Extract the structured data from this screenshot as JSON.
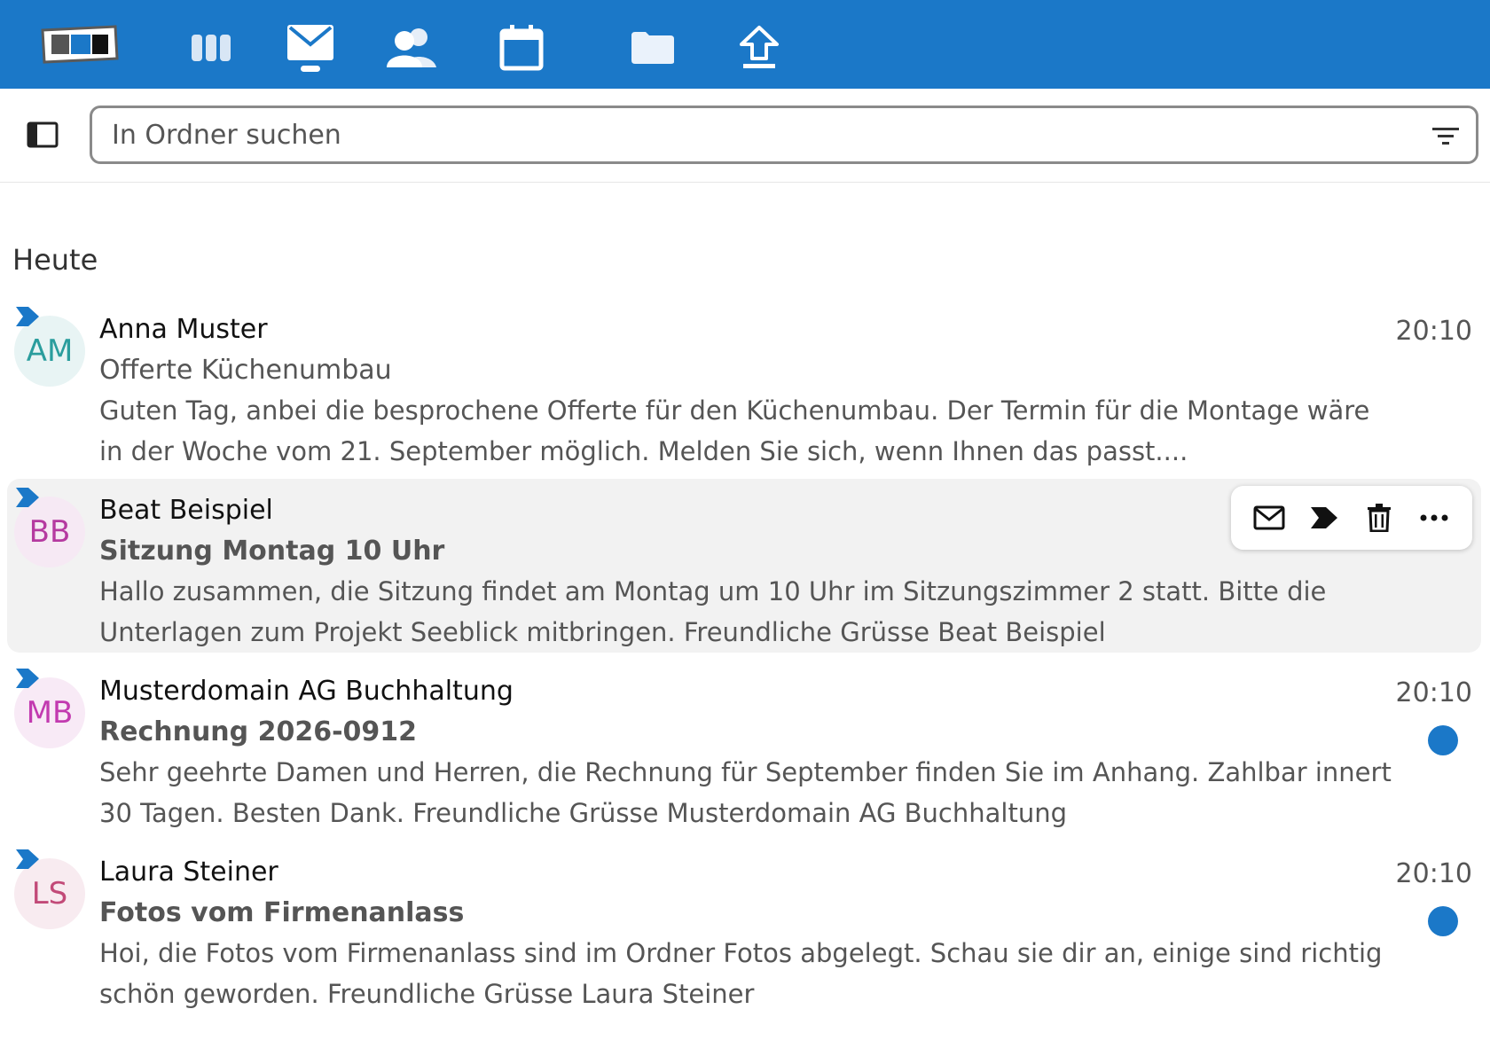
{
  "colors": {
    "brand": "#1b78c8",
    "hover_row": "#f2f2f2",
    "unread_dot": "#1b78c8"
  },
  "topbar": {
    "apps": [
      {
        "icon": "dashboard-icon"
      },
      {
        "icon": "mail-icon"
      },
      {
        "icon": "contacts-icon"
      },
      {
        "icon": "calendar-icon"
      },
      {
        "icon": "files-icon"
      },
      {
        "icon": "upload-icon"
      }
    ]
  },
  "search": {
    "placeholder": "In Ordner suchen",
    "value": ""
  },
  "list": {
    "section_heading": "Heute",
    "messages": [
      {
        "initials": "AM",
        "avatar_color": "#2a9d9d",
        "avatar_bg": "#e8f4f4",
        "sender": "Anna Muster",
        "subject": "Offerte Küchenumbau",
        "unread": false,
        "preview": "Guten Tag, anbei die besprochene Offerte für den Küchenumbau. Der Termin für die Montage wäre in der Woche vom 21. September möglich. Melden Sie sich, wenn Ihnen das passt....",
        "time": "20:10"
      },
      {
        "initials": "BB",
        "avatar_color": "#b53aa0",
        "avatar_bg": "#f6e9f4",
        "sender": "Beat Beispiel",
        "subject": "Sitzung Montag 10 Uhr",
        "unread": true,
        "preview": "Hallo zusammen, die Sitzung findet am Montag um 10 Uhr im Sitzungszimmer 2 statt. Bitte die Unterlagen zum Projekt Seeblick mitbringen. Freundliche Grüsse Beat Beispiel",
        "time": ""
      },
      {
        "initials": "MB",
        "avatar_color": "#c23ab0",
        "avatar_bg": "#f8eaf6",
        "sender": "Musterdomain AG Buchhaltung",
        "subject": "Rechnung 2026-0912",
        "unread": true,
        "preview": "Sehr geehrte Damen und Herren, die Rechnung für September finden Sie im Anhang. Zahlbar innert 30 Tagen. Besten Dank. Freundliche Grüsse Musterdomain AG Buchhaltung",
        "time": "20:10"
      },
      {
        "initials": "LS",
        "avatar_color": "#c24a78",
        "avatar_bg": "#f8ebf0",
        "sender": "Laura Steiner",
        "subject": "Fotos vom Firmenanlass",
        "unread": true,
        "preview": "Hoi, die Fotos vom Firmenanlass sind im Ordner Fotos abgelegt. Schau sie dir an, einige sind richtig schön geworden. Freundliche Grüsse Laura Steiner",
        "time": "20:10"
      }
    ]
  },
  "hover_actions": [
    {
      "icon": "mark-unread-mail-icon"
    },
    {
      "icon": "important-tag-icon"
    },
    {
      "icon": "trash-icon"
    },
    {
      "icon": "more-options-icon"
    }
  ]
}
